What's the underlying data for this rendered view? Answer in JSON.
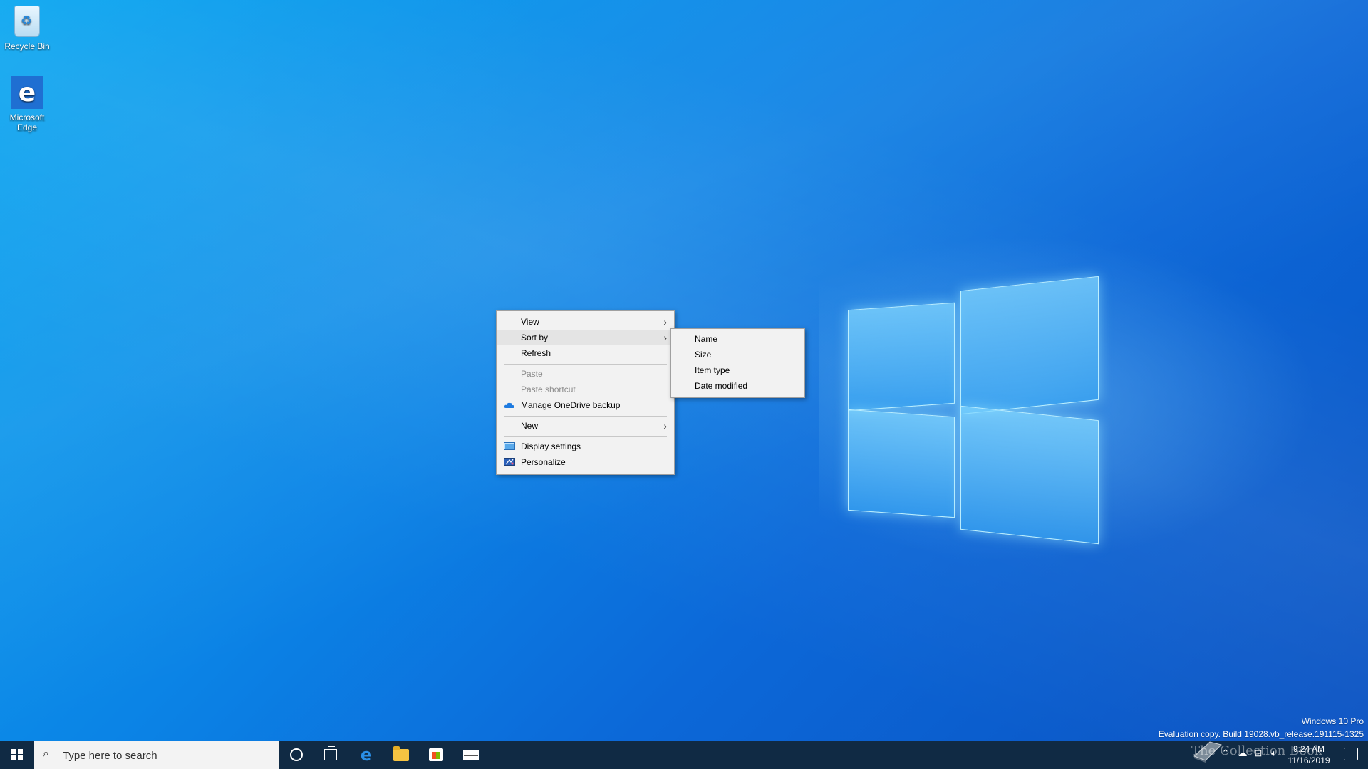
{
  "desktop": {
    "icons": [
      {
        "label": "Recycle Bin",
        "icon": "recycle-bin-icon"
      },
      {
        "label": "Microsoft Edge",
        "icon": "edge-icon"
      }
    ]
  },
  "context_menu": {
    "items": [
      {
        "label": "View",
        "has_submenu": true,
        "enabled": true
      },
      {
        "label": "Sort by",
        "has_submenu": true,
        "enabled": true,
        "highlighted": true
      },
      {
        "label": "Refresh",
        "enabled": true
      },
      {
        "label": "Paste",
        "enabled": false
      },
      {
        "label": "Paste shortcut",
        "enabled": false
      },
      {
        "label": "Manage OneDrive backup",
        "enabled": true,
        "icon": "onedrive-icon"
      },
      {
        "label": "New",
        "has_submenu": true,
        "enabled": true
      },
      {
        "label": "Display settings",
        "enabled": true,
        "icon": "display-icon"
      },
      {
        "label": "Personalize",
        "enabled": true,
        "icon": "personalize-icon"
      }
    ]
  },
  "submenu": {
    "items": [
      {
        "label": "Name"
      },
      {
        "label": "Size"
      },
      {
        "label": "Item type"
      },
      {
        "label": "Date modified"
      }
    ]
  },
  "taskbar": {
    "search_placeholder": "Type here to search",
    "pinned": [
      "cortana-icon",
      "task-view-icon",
      "edge-icon",
      "file-explorer-icon",
      "store-icon",
      "mail-icon"
    ],
    "clock": {
      "time": "9:24 AM",
      "date": "11/16/2019"
    }
  },
  "watermark": {
    "line1": "Windows 10 Pro",
    "line2": "Evaluation copy. Build 19028.vb_release.191115-1325"
  },
  "overlay": {
    "text": "The Collection Book"
  },
  "colors": {
    "taskbar": "#102a44",
    "menu_bg": "#f2f2f2",
    "desktop_accent": "#0a84e6"
  }
}
